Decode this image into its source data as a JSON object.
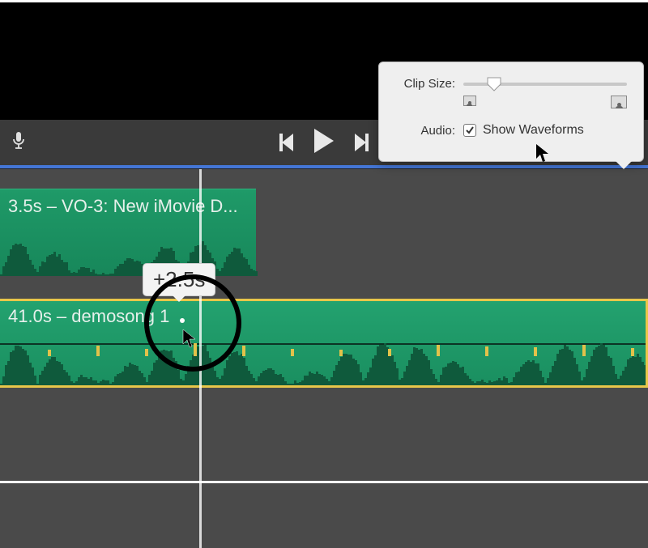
{
  "popover": {
    "clip_size_label": "Clip Size:",
    "audio_label": "Audio:",
    "show_waveforms_label": "Show Waveforms",
    "show_waveforms_checked": true,
    "slider_value_pct": 16
  },
  "clips": {
    "clip1_label": "3.5s – VO-3: New iMovie D...",
    "clip2_label": "41.0s – demosong 1"
  },
  "tooltip": {
    "text": "+2.5s"
  }
}
